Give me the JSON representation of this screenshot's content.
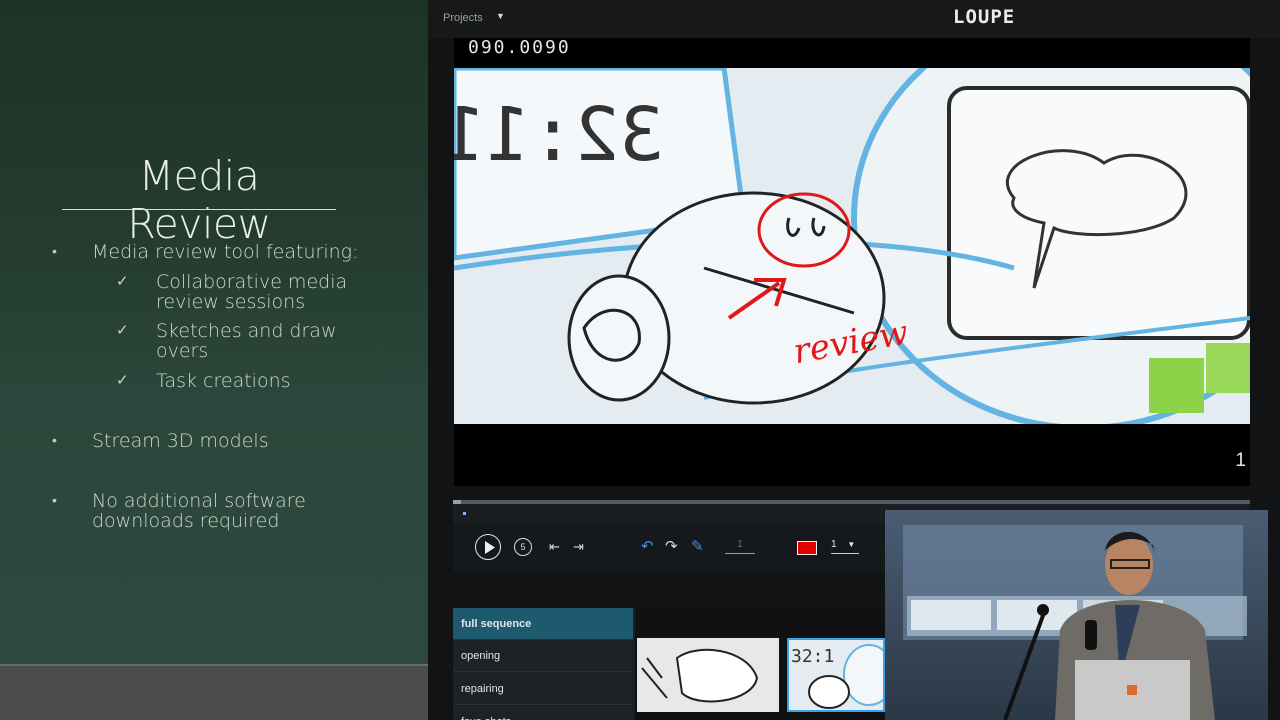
{
  "slide": {
    "title": "Media Review",
    "bullets": [
      {
        "text": "Media review tool featuring:"
      },
      {
        "text": "Stream 3D models"
      },
      {
        "text": "No additional software downloads required"
      }
    ],
    "sub_items": [
      "Collaborative media review sessions",
      "Sketches and draw overs",
      "Task creations"
    ]
  },
  "app": {
    "projects_label": "Projects",
    "brand": "LOUPE",
    "viewer": {
      "timecode": "090.0090",
      "frame_number": "1",
      "annotation_text": "review",
      "sketch_digits": "32:11"
    },
    "playback": {
      "progress": 0.01
    },
    "controls": {
      "page_value": "1",
      "brush_size": "1",
      "brush_caret": "▼",
      "annotation_color": "#e30000",
      "icons": [
        "play-icon",
        "replay-5-icon",
        "skip-start-icon",
        "skip-end-icon",
        "undo-icon",
        "redo-icon",
        "pencil-icon"
      ]
    },
    "sequences": [
      {
        "label": "full sequence",
        "active": true
      },
      {
        "label": "opening",
        "active": false
      },
      {
        "label": "repairing",
        "active": false
      },
      {
        "label": "fave shots",
        "active": false
      }
    ]
  },
  "presenter_overlay": {
    "visible": true
  }
}
